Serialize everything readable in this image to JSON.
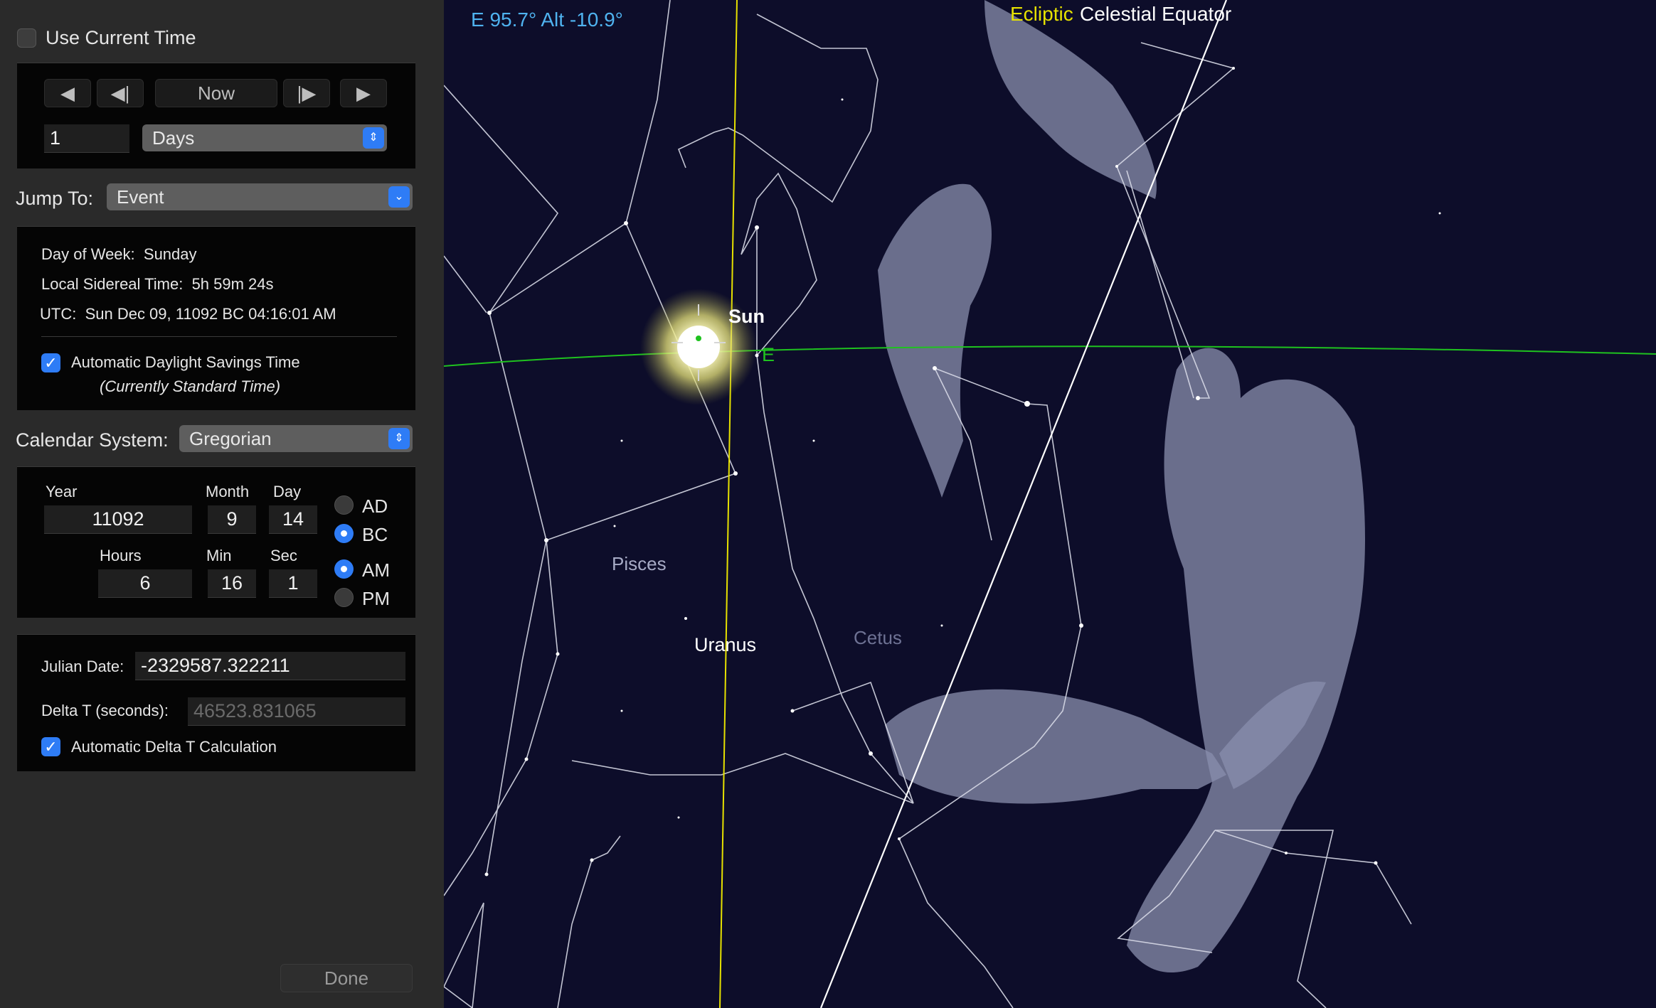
{
  "panel": {
    "use_current_time": "Use Current Time",
    "nav": {
      "prev": "◀",
      "step_back": "◀|",
      "now": "Now",
      "step_fwd": "|▶",
      "next": "▶"
    },
    "step_value": "1",
    "step_unit": "Days",
    "jump_to_label": "Jump To:",
    "jump_to_value": "Event",
    "info": {
      "dow_label": "Day of Week:",
      "dow_value": "Sunday",
      "lst_label": "Local Sidereal Time:",
      "lst_value": "5h 59m 24s",
      "utc_label": "UTC:",
      "utc_value": "Sun Dec 09, 11092 BC 04:16:01 AM",
      "dst_label": "Automatic Daylight Savings Time",
      "dst_note": "(Currently Standard Time)"
    },
    "calendar_label": "Calendar System:",
    "calendar_value": "Gregorian",
    "date": {
      "year_label": "Year",
      "year": "11092",
      "month_label": "Month",
      "month": "9",
      "day_label": "Day",
      "day": "14",
      "hours_label": "Hours",
      "hours": "6",
      "min_label": "Min",
      "min": "16",
      "sec_label": "Sec",
      "sec": "1",
      "ad": "AD",
      "bc": "BC",
      "am": "AM",
      "pm": "PM"
    },
    "julian_label": "Julian Date:",
    "julian_value": "-2329587.322211",
    "delta_label": "Delta T (seconds):",
    "delta_value": "46523.831065",
    "auto_delta_label": "Automatic Delta T Calculation",
    "done": "Done"
  },
  "sky": {
    "pointing": "E 95.7° Alt -10.9°",
    "ecliptic": "Ecliptic",
    "equator": "Celestial Equator",
    "sun": "Sun",
    "east_marker": "E",
    "pisces": "Pisces",
    "uranus": "Uranus",
    "cetus": "Cetus"
  },
  "colors": {
    "accent": "#2e7cf6",
    "sky_bg": "#0d0d2a",
    "ecliptic": "#e6e100",
    "horizon": "#1fc21f",
    "pointing_text": "#4fb3f0"
  }
}
